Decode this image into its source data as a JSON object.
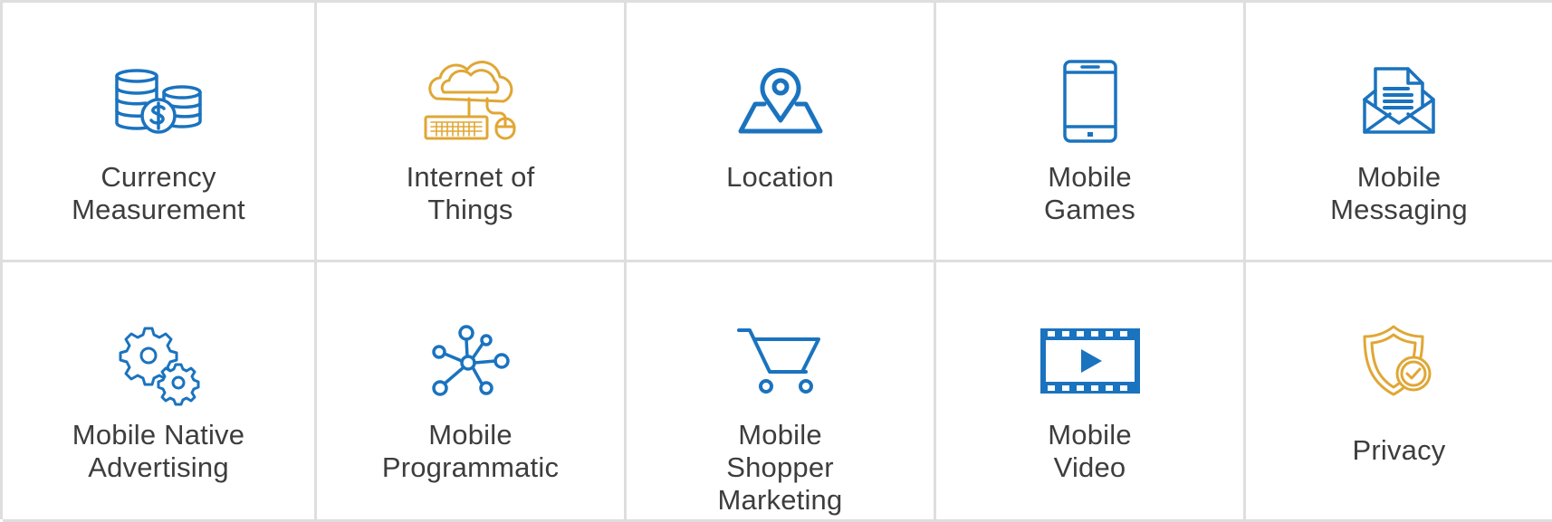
{
  "colors": {
    "blue": "#1a73bf",
    "gold": "#e0a735",
    "border": "#dedede",
    "text": "#3d3d3d"
  },
  "tiles": [
    {
      "label": "Currency\nMeasurement",
      "icon": "coins-dollar-icon",
      "color": "#1a73bf"
    },
    {
      "label": "Internet of\nThings",
      "icon": "cloud-keyboard-mouse-icon",
      "color": "#e0a735"
    },
    {
      "label": "Location",
      "icon": "map-pin-icon",
      "color": "#1a73bf"
    },
    {
      "label": "Mobile\nGames",
      "icon": "smartphone-icon",
      "color": "#1a73bf"
    },
    {
      "label": "Mobile\nMessaging",
      "icon": "envelope-document-icon",
      "color": "#1a73bf"
    },
    {
      "label": "Mobile Native\nAdvertising",
      "icon": "gears-icon",
      "color": "#1a73bf"
    },
    {
      "label": "Mobile\nProgrammatic",
      "icon": "network-nodes-icon",
      "color": "#1a73bf"
    },
    {
      "label": "Mobile\nShopper\nMarketing",
      "icon": "shopping-cart-icon",
      "color": "#1a73bf"
    },
    {
      "label": "Mobile\nVideo",
      "icon": "film-play-icon",
      "color": "#1a73bf"
    },
    {
      "label": "Privacy",
      "icon": "shield-check-icon",
      "color": "#e0a735"
    }
  ]
}
